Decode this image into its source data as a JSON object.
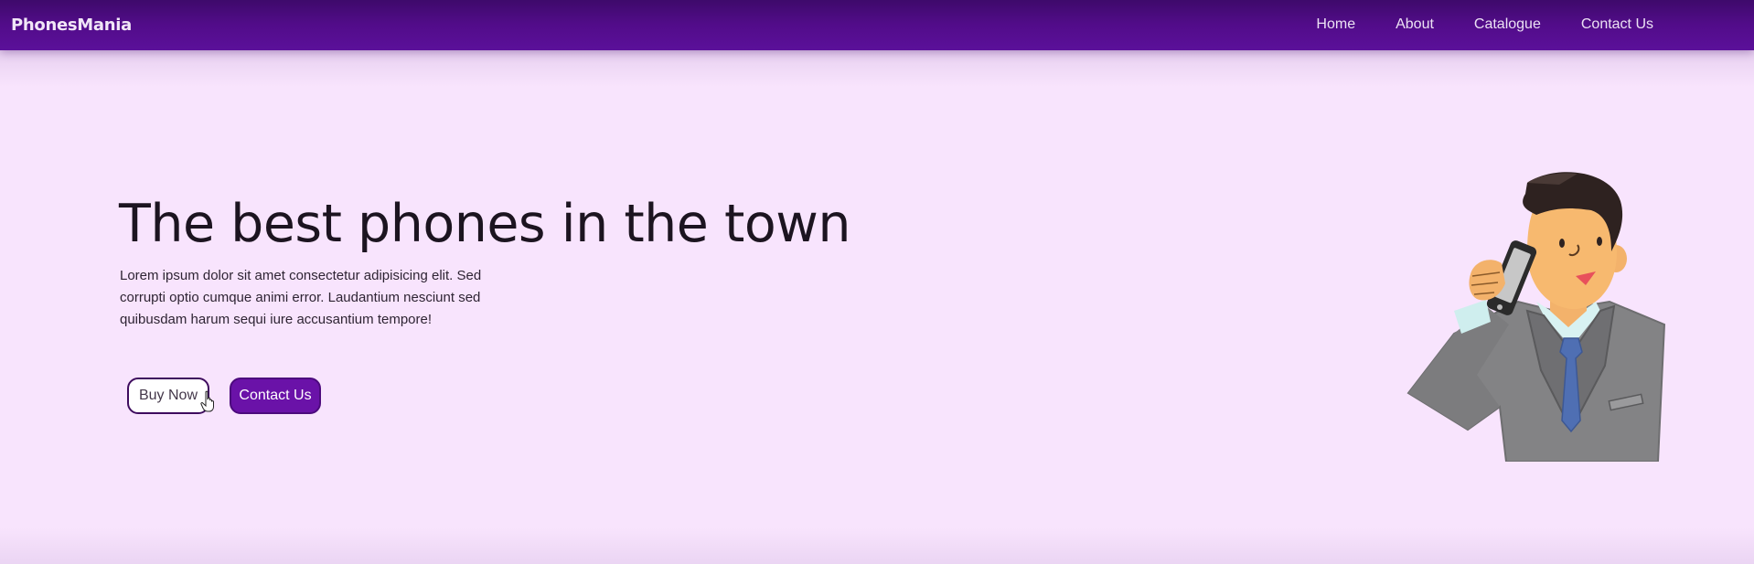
{
  "navbar": {
    "brand": "PhonesMania",
    "links": [
      "Home",
      "About",
      "Catalogue",
      "Contact Us"
    ]
  },
  "hero": {
    "title": "The best phones in the town",
    "text": "Lorem ipsum dolor sit amet consectetur adipisicing elit. Sed corrupti optio cumque animi error. Laudantium nesciunt sed quibusdam harum sequi iure accusantium tempore!",
    "buttons": {
      "buy_label": "Buy Now",
      "contact_label": "Contact Us"
    }
  },
  "colors": {
    "navbar": "#520c8a",
    "background": "#f8e4fd",
    "primary_button": "#6a12a8"
  },
  "icons": {
    "illustration": "businessman-on-phone-illustration",
    "cursor": "hand-pointer-cursor"
  }
}
